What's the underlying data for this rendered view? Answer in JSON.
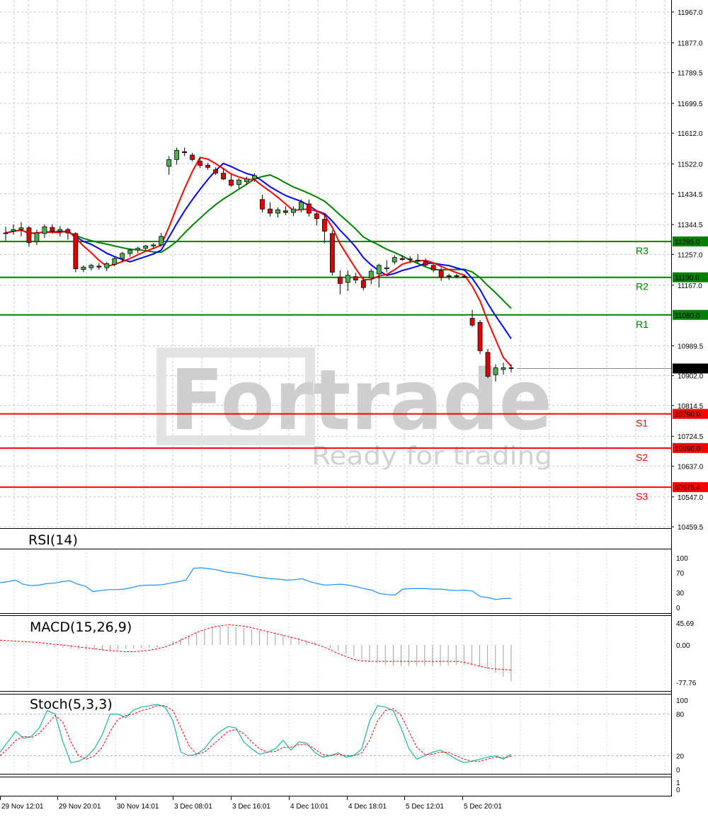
{
  "price_axis_labels": [
    "11967.0",
    "11877.0",
    "11789.5",
    "11699.5",
    "11612.0",
    "11522.0",
    "11434.5",
    "11344.5",
    "11257.0",
    "11167.0",
    "10989.5",
    "10902.0",
    "10814.5",
    "10724.5",
    "10637.0",
    "10547.0",
    "10459.5"
  ],
  "current_price": "10923.0",
  "levels": [
    {
      "name": "R3",
      "value": 11295,
      "label": "11295.0",
      "color": "#008000"
    },
    {
      "name": "R2",
      "value": 11190,
      "label": "11190.0",
      "color": "#008000"
    },
    {
      "name": "R1",
      "value": 11080,
      "label": "11080.0",
      "color": "#008000"
    },
    {
      "name": "S1",
      "value": 10790,
      "label": "10790.0",
      "color": "#ff0000"
    },
    {
      "name": "S2",
      "value": 10690,
      "label": "10690.0",
      "color": "#ff0000"
    },
    {
      "name": "S3",
      "value": 10575.4,
      "label": "10575.4",
      "color": "#ff0000"
    }
  ],
  "time_labels": [
    "29 Nov 12:01",
    "29 Nov 20:01",
    "30 Nov 14:01",
    "3 Dec 08:01",
    "3 Dec 16:01",
    "4 Dec 10:01",
    "4 Dec 18:01",
    "5 Dec 12:01",
    "5 Dec 20:01"
  ],
  "watermark": {
    "brand": "Fortrade",
    "tagline": "Ready for trading"
  },
  "rsi": {
    "title": "RSI(14)",
    "ticks": [
      "100",
      "70",
      "30",
      "0"
    ]
  },
  "macd": {
    "title": "MACD(15,26,9)",
    "ticks": [
      "45.69",
      "0.00",
      "-77.76"
    ]
  },
  "stoch": {
    "title": "Stoch(5,3,3)",
    "ticks": [
      "100",
      "80",
      "20",
      "0"
    ]
  },
  "bottom_panel": {
    "ticks": [
      "1",
      "0"
    ]
  },
  "colors": {
    "bull": "#4caf50",
    "bear": "#e00000",
    "ma_fast": "#ff0000",
    "ma_mid": "#0000ff",
    "ma_slow": "#008000",
    "rsi": "#1e90ff",
    "stoch_main": "#20b2aa",
    "stoch_signal": "#ff0000"
  },
  "chart_data": [
    {
      "type": "candlestick",
      "title": "",
      "ylim": [
        10459.5,
        11967
      ],
      "x_labels": [
        "29 Nov 12:01",
        "29 Nov 20:01",
        "30 Nov 14:01",
        "3 Dec 08:01",
        "3 Dec 16:01",
        "4 Dec 10:01",
        "4 Dec 18:01",
        "5 Dec 12:01",
        "5 Dec 20:01"
      ],
      "ohlc": [
        [
          11318,
          11338,
          11295,
          11320
        ],
        [
          11325,
          11345,
          11315,
          11330
        ],
        [
          11330,
          11352,
          11310,
          11335
        ],
        [
          11335,
          11340,
          11280,
          11292
        ],
        [
          11295,
          11330,
          11285,
          11320
        ],
        [
          11318,
          11345,
          11305,
          11338
        ],
        [
          11336,
          11345,
          11318,
          11325
        ],
        [
          11325,
          11340,
          11310,
          11330
        ],
        [
          11330,
          11335,
          11300,
          11320
        ],
        [
          11318,
          11322,
          11205,
          11215
        ],
        [
          11213,
          11225,
          11205,
          11220
        ],
        [
          11218,
          11230,
          11210,
          11225
        ],
        [
          11223,
          11232,
          11212,
          11220
        ],
        [
          11218,
          11235,
          11208,
          11230
        ],
        [
          11228,
          11250,
          11222,
          11245
        ],
        [
          11245,
          11265,
          11235,
          11260
        ],
        [
          11260,
          11275,
          11250,
          11270
        ],
        [
          11270,
          11280,
          11260,
          11275
        ],
        [
          11275,
          11285,
          11268,
          11282
        ],
        [
          11282,
          11290,
          11275,
          11285
        ],
        [
          11285,
          11320,
          11280,
          11310
        ],
        [
          11515,
          11545,
          11490,
          11535
        ],
        [
          11535,
          11570,
          11520,
          11562
        ],
        [
          11558,
          11570,
          11545,
          11555
        ],
        [
          11548,
          11555,
          11530,
          11535
        ],
        [
          11530,
          11540,
          11510,
          11518
        ],
        [
          11518,
          11525,
          11505,
          11512
        ],
        [
          11505,
          11512,
          11490,
          11495
        ],
        [
          11495,
          11510,
          11475,
          11478
        ],
        [
          11475,
          11490,
          11455,
          11460
        ],
        [
          11462,
          11480,
          11450,
          11475
        ],
        [
          11470,
          11485,
          11460,
          11478
        ],
        [
          11478,
          11495,
          11470,
          11488
        ],
        [
          11418,
          11432,
          11380,
          11390
        ],
        [
          11390,
          11410,
          11368,
          11378
        ],
        [
          11378,
          11395,
          11365,
          11388
        ],
        [
          11385,
          11398,
          11372,
          11380
        ],
        [
          11380,
          11398,
          11370,
          11390
        ],
        [
          11388,
          11418,
          11380,
          11410
        ],
        [
          11405,
          11418,
          11368,
          11378
        ],
        [
          11376,
          11385,
          11342,
          11362
        ],
        [
          11360,
          11375,
          11290,
          11325
        ],
        [
          11318,
          11328,
          11195,
          11205
        ],
        [
          11190,
          11210,
          11140,
          11172
        ],
        [
          11175,
          11210,
          11150,
          11196
        ],
        [
          11192,
          11203,
          11172,
          11182
        ],
        [
          11180,
          11192,
          11152,
          11160
        ],
        [
          11188,
          11215,
          11170,
          11208
        ],
        [
          11200,
          11230,
          11160,
          11225
        ],
        [
          11215,
          11240,
          11205,
          11218
        ],
        [
          11235,
          11255,
          11228,
          11248
        ],
        [
          11245,
          11255,
          11238,
          11242
        ],
        [
          11242,
          11252,
          11232,
          11244
        ],
        [
          11240,
          11258,
          11230,
          11238
        ],
        [
          11236,
          11245,
          11222,
          11226
        ],
        [
          11225,
          11230,
          11205,
          11212
        ],
        [
          11210,
          11218,
          11180,
          11190
        ],
        [
          11192,
          11200,
          11182,
          11195
        ],
        [
          11195,
          11200,
          11187,
          11193
        ],
        [
          11193,
          11198,
          11188,
          11190
        ],
        [
          11070,
          11095,
          11045,
          11050
        ],
        [
          11058,
          11065,
          10965,
          10975
        ],
        [
          10970,
          10980,
          10895,
          10900
        ],
        [
          10905,
          10935,
          10885,
          10925
        ],
        [
          10920,
          10940,
          10905,
          10925
        ],
        [
          10925,
          10935,
          10912,
          10923
        ]
      ]
    },
    {
      "type": "line",
      "name": "RSI(14)",
      "ylim": [
        0,
        100
      ],
      "values": [
        50,
        52,
        55,
        47,
        44,
        45,
        48,
        49,
        52,
        54,
        47,
        43,
        32,
        34,
        36,
        36,
        37,
        40,
        44,
        45,
        45,
        46,
        49,
        52,
        55,
        79,
        80,
        78,
        76,
        72,
        70,
        68,
        65,
        62,
        60,
        58,
        57,
        55,
        56,
        58,
        52,
        48,
        45,
        46,
        47,
        45,
        42,
        38,
        35,
        28,
        26,
        25,
        37,
        38,
        38,
        38,
        37,
        37,
        35,
        34,
        35,
        33,
        22,
        20,
        16,
        18,
        18
      ]
    },
    {
      "type": "bar+line",
      "name": "MACD(15,26,9)",
      "ylim": [
        -77.76,
        45.69
      ],
      "histogram": [
        -3,
        -2,
        -2,
        -1,
        -1,
        -2,
        -3,
        -5,
        -6,
        -8,
        -9,
        -10,
        -11,
        -11,
        -11,
        -10,
        -9,
        -8,
        -7,
        -6,
        -5,
        2,
        8,
        14,
        20,
        26,
        32,
        38,
        40,
        40,
        38,
        35,
        32,
        30,
        28,
        26,
        22,
        18,
        14,
        10,
        6,
        0,
        -6,
        -12,
        -18,
        -24,
        -30,
        -34,
        -38,
        -42,
        -44,
        -44,
        -44,
        -44,
        -44,
        -44,
        -44,
        -43,
        -42,
        -42,
        -42,
        -46,
        -50,
        -58,
        -66,
        -76
      ],
      "signal": [
        10,
        9,
        8,
        7,
        6,
        5,
        3,
        1,
        0,
        -2,
        -4,
        -6,
        -8,
        -10,
        -12,
        -13,
        -14,
        -14,
        -13,
        -11,
        -8,
        -4,
        2,
        10,
        18,
        26,
        32,
        37,
        40,
        42,
        41,
        39,
        36,
        32,
        28,
        24,
        20,
        16,
        12,
        7,
        2,
        -3,
        -10,
        -18,
        -24,
        -30,
        -33,
        -34,
        -34,
        -34,
        -34,
        -34,
        -34,
        -34,
        -34,
        -34,
        -34,
        -34,
        -34,
        -36,
        -40,
        -44,
        -48,
        -50,
        -51,
        -52
      ]
    },
    {
      "type": "line",
      "name": "Stoch(5,3,3)",
      "ylim": [
        0,
        100
      ],
      "main": [
        25,
        40,
        55,
        45,
        48,
        60,
        85,
        80,
        40,
        10,
        12,
        18,
        30,
        50,
        80,
        80,
        75,
        86,
        90,
        92,
        94,
        90,
        70,
        25,
        20,
        22,
        30,
        45,
        55,
        62,
        60,
        40,
        30,
        22,
        25,
        30,
        42,
        28,
        40,
        38,
        25,
        18,
        20,
        24,
        18,
        20,
        30,
        70,
        92,
        90,
        85,
        60,
        30,
        15,
        20,
        25,
        28,
        22,
        15,
        10,
        12,
        15,
        18,
        20,
        15,
        22
      ],
      "signal": [
        20,
        30,
        42,
        48,
        46,
        52,
        65,
        78,
        68,
        40,
        20,
        15,
        20,
        32,
        55,
        72,
        78,
        80,
        85,
        88,
        92,
        92,
        85,
        60,
        35,
        22,
        25,
        35,
        45,
        55,
        58,
        52,
        40,
        30,
        25,
        26,
        32,
        32,
        36,
        36,
        30,
        22,
        20,
        22,
        20,
        20,
        24,
        42,
        70,
        85,
        88,
        78,
        55,
        32,
        22,
        22,
        25,
        25,
        20,
        15,
        12,
        12,
        15,
        18,
        17,
        19
      ]
    }
  ]
}
